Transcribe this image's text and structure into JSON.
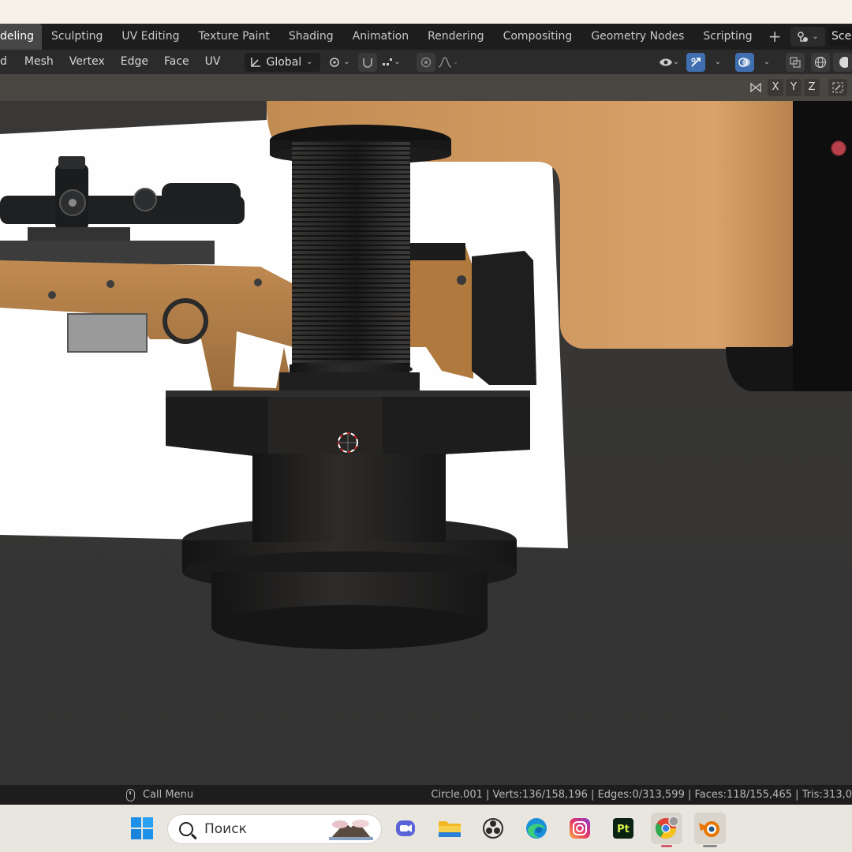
{
  "workspace_tabs": [
    "deling",
    "Sculpting",
    "UV Editing",
    "Texture Paint",
    "Shading",
    "Animation",
    "Rendering",
    "Compositing",
    "Geometry Nodes",
    "Scripting"
  ],
  "active_tab_index": 0,
  "scene_label": "Scen",
  "header": {
    "menus": [
      "d",
      "Mesh",
      "Vertex",
      "Edge",
      "Face",
      "UV"
    ],
    "transform_orientation": "Global"
  },
  "viewport": {
    "axes": [
      "X",
      "Y",
      "Z"
    ]
  },
  "status": {
    "hint": "Call Menu",
    "stats": "Circle.001 | Verts:136/158,196 | Edges:0/313,599 | Faces:118/155,465 | Tris:313,0"
  },
  "taskbar": {
    "search_placeholder": "Поиск"
  },
  "colors": {
    "accent_blue": "#3f6fb0",
    "stock_tan": "#b07d44",
    "cabinet_tan": "#c48d55",
    "gizmo_red": "#c0392b"
  }
}
